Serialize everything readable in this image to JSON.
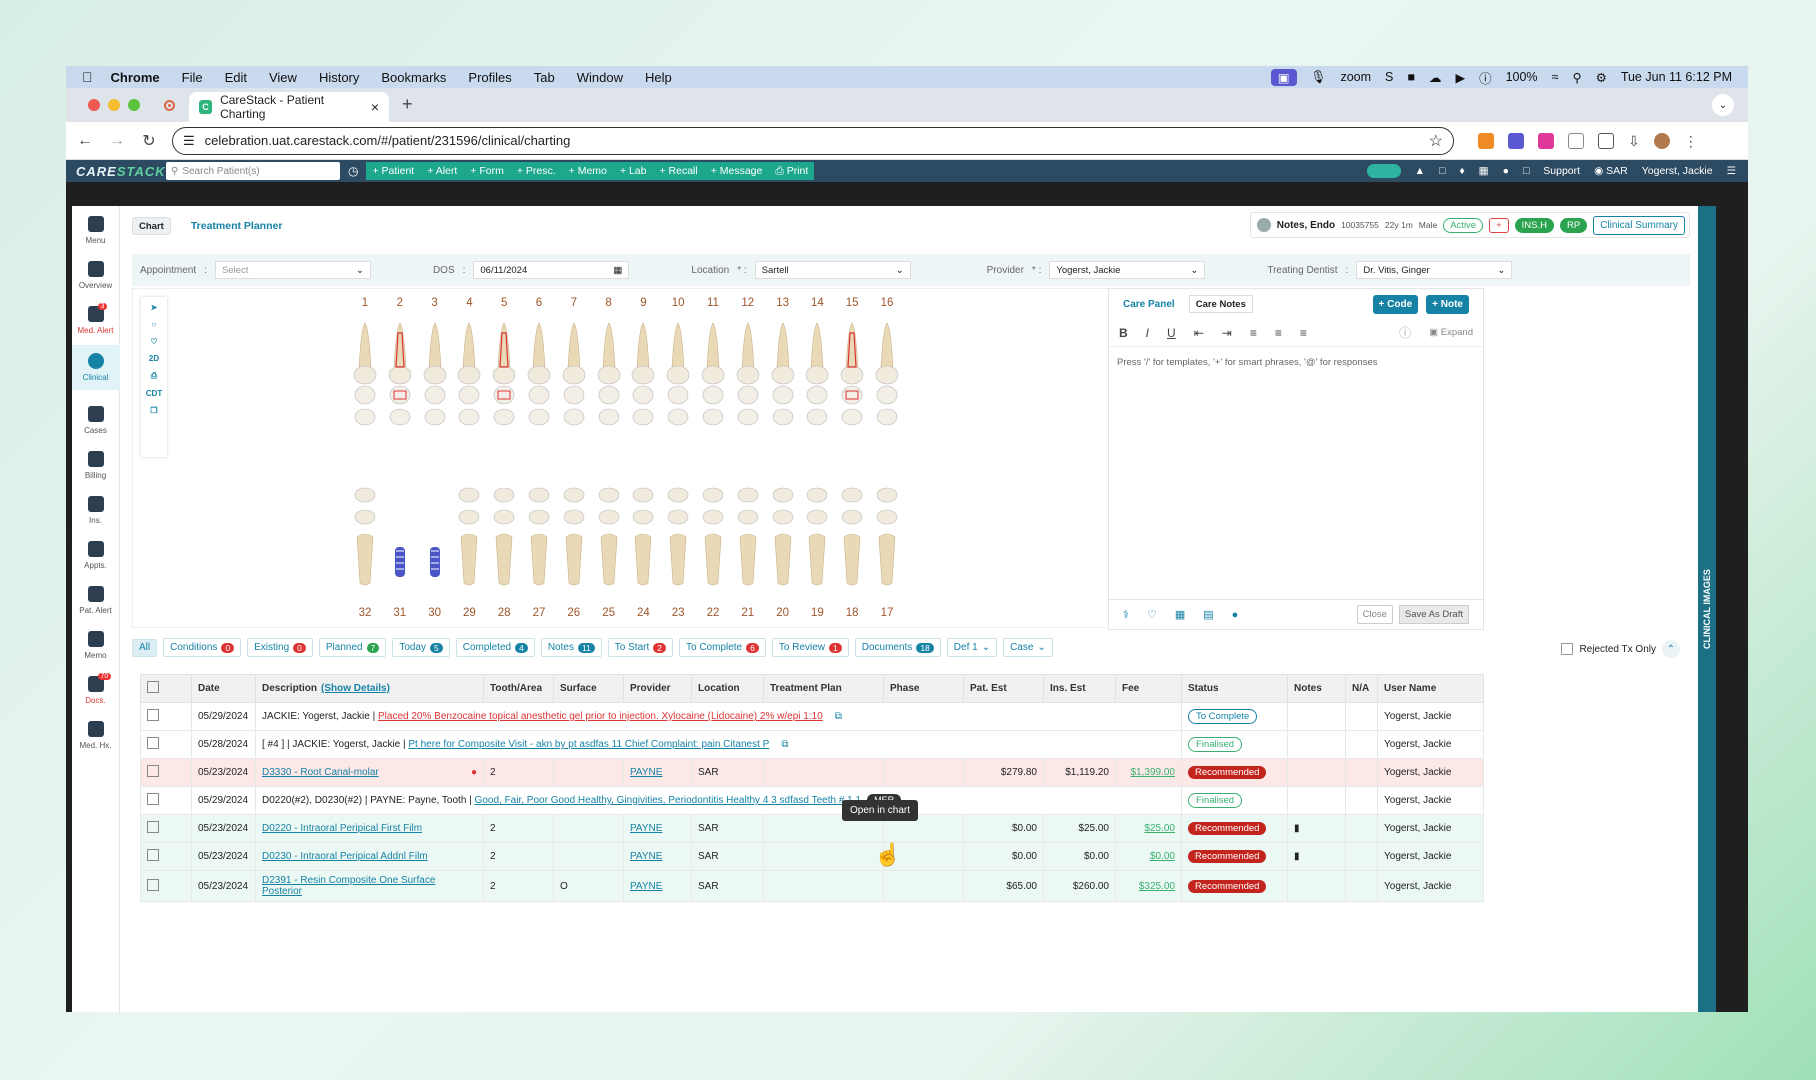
{
  "menubar": {
    "app": "Chrome",
    "items": [
      "File",
      "Edit",
      "View",
      "History",
      "Bookmarks",
      "Profiles",
      "Tab",
      "Window",
      "Help"
    ],
    "zoom": "zoom",
    "battery": "100%",
    "datetime": "Tue Jun 11  6:12 PM"
  },
  "browser": {
    "tab_title": "CareStack - Patient Charting",
    "url": "celebration.uat.carestack.com/#/patient/231596/clinical/charting"
  },
  "appnav": {
    "search_placeholder": "Search Patient(s)",
    "quick": [
      "+ Patient",
      "+ Alert",
      "+ Form",
      "+ Presc.",
      "+ Memo",
      "+ Lab",
      "+ Recall",
      "+ Message",
      "Print"
    ],
    "support": "Support",
    "location": "SAR",
    "user": "Yogerst, Jackie"
  },
  "leftnav": [
    {
      "label": "Menu",
      "icon": "grid-icon"
    },
    {
      "label": "Overview",
      "icon": "person-icon"
    },
    {
      "label": "Med. Alert",
      "icon": "medical-alert-icon",
      "badge": "3"
    },
    {
      "label": "Clinical",
      "icon": "tooth-icon"
    },
    {
      "label": "Cases",
      "icon": "clipboard-icon"
    },
    {
      "label": "Billing",
      "icon": "invoice-icon"
    },
    {
      "label": "Ins.",
      "icon": "shield-icon"
    },
    {
      "label": "Appts.",
      "icon": "calendar-icon"
    },
    {
      "label": "Pat. Alert",
      "icon": "warning-icon"
    },
    {
      "label": "Memo",
      "icon": "memo-icon"
    },
    {
      "label": "Docs.",
      "icon": "docs-icon",
      "badge": "70"
    },
    {
      "label": "Med. Hx.",
      "icon": "history-icon"
    }
  ],
  "subtabs": {
    "chart": "Chart",
    "planner": "Treatment Planner"
  },
  "patient": {
    "name": "Notes, Endo",
    "id": "10035755",
    "age": "22y 1m",
    "sex": "Male",
    "status": "Active",
    "ins": "INS.H",
    "rp": "RP",
    "summary": "Clinical Summary"
  },
  "filters": {
    "appointment_label": "Appointment",
    "appointment_value": "Select",
    "dos_label": "DOS",
    "dos_value": "06/11/2024",
    "location_label": "Location",
    "location_value": "Sartell",
    "provider_label": "Provider",
    "provider_value": "Yogerst, Jackie",
    "dentist_label": "Treating Dentist",
    "dentist_value": "Dr. Vitis, Ginger"
  },
  "teeth_upper": [
    "1",
    "2",
    "3",
    "4",
    "5",
    "6",
    "7",
    "8",
    "9",
    "10",
    "11",
    "12",
    "13",
    "14",
    "15",
    "16"
  ],
  "teeth_lower": [
    "32",
    "31",
    "30",
    "29",
    "28",
    "27",
    "26",
    "25",
    "24",
    "23",
    "22",
    "21",
    "20",
    "19",
    "18",
    "17"
  ],
  "care": {
    "tab_panel": "Care Panel",
    "tab_notes": "Care Notes",
    "code_btn": "+ Code",
    "note_btn": "+ Note",
    "expand": "Expand",
    "placeholder": "Press '/' for templates, '+' for smart phrases, '@' for responses",
    "close": "Close",
    "save": "Save As Draft",
    "side": "CLINICAL IMAGES"
  },
  "chips": [
    {
      "label": "All",
      "count": ""
    },
    {
      "label": "Conditions",
      "count": "0",
      "color": "#d33"
    },
    {
      "label": "Existing",
      "count": "0",
      "color": "#d33"
    },
    {
      "label": "Planned",
      "count": "7",
      "color": "#2ba34f"
    },
    {
      "label": "Today",
      "count": "5",
      "color": "#1683a6"
    },
    {
      "label": "Completed",
      "count": "4",
      "color": "#1683a6"
    },
    {
      "label": "Notes",
      "count": "11",
      "color": "#1683a6"
    },
    {
      "label": "To Start",
      "count": "2",
      "color": "#d33"
    },
    {
      "label": "To Complete",
      "count": "6",
      "color": "#d33"
    },
    {
      "label": "To Review",
      "count": "1",
      "color": "#d33"
    },
    {
      "label": "Documents",
      "count": "18",
      "color": "#1683a6"
    },
    {
      "label": "Def 1",
      "count": ""
    },
    {
      "label": "Case",
      "count": ""
    }
  ],
  "rejected": "Rejected Tx Only",
  "table": {
    "headers": [
      "Date",
      "Description",
      "Tooth/Area",
      "Surface",
      "Provider",
      "Location",
      "Treatment Plan",
      "Phase",
      "Pat. Est",
      "Ins. Est",
      "Fee",
      "Status",
      "Notes",
      "N/A",
      "User Name"
    ],
    "show_details": "(Show Details)",
    "rows": [
      {
        "date": "05/29/2024",
        "desc_prefix": "JACKIE: Yogerst, Jackie | ",
        "desc_link": "Placed 20% Benzocaine topical anesthetic gel prior to injection. Xylocaine (Lidocaine) 2% w/epi 1:10",
        "tooth": "",
        "surface": "",
        "provider": "",
        "location": "",
        "pat": "",
        "ins": "",
        "fee": "",
        "status": "To Complete",
        "user": "Yogerst, Jackie"
      },
      {
        "date": "05/28/2024",
        "desc_prefix": "[ #4 ] | JACKIE: Yogerst, Jackie | ",
        "desc_link": "Pt here for Composite Visit - akn by pt asdfas  11  Chief Complaint: pain  Citanest P",
        "tooth": "",
        "surface": "",
        "provider": "",
        "location": "",
        "pat": "",
        "ins": "",
        "fee": "",
        "status": "Finalised",
        "user": "Yogerst, Jackie"
      },
      {
        "date": "05/23/2024",
        "desc_prefix": "",
        "desc_link": "D3330 - Root Canal-molar",
        "tooth": "2",
        "surface": "",
        "provider": "PAYNE",
        "location": "SAR",
        "pat": "$279.80",
        "ins": "$1,119.20",
        "fee": "$1,399.00",
        "status": "Recommended",
        "user": "Yogerst, Jackie"
      },
      {
        "date": "05/29/2024",
        "desc_prefix": "D0220(#2), D0230(#2) | PAYNE: Payne, Tooth | ",
        "desc_link": "Good, Fair, Poor Good Healthy, Gingivities, Periodontitis Healthy  4 3 sdfasd Teeth # 1 1",
        "tooth": "",
        "surface": "",
        "provider": "",
        "location": "",
        "pat": "",
        "ins": "",
        "fee": "",
        "status": "Finalised",
        "user": "Yogerst, Jackie",
        "mer": "MER"
      },
      {
        "date": "05/23/2024",
        "desc_prefix": "",
        "desc_link": "D0220 - Intraoral Peripical First Film",
        "tooth": "2",
        "surface": "",
        "provider": "PAYNE",
        "location": "SAR",
        "pat": "$0.00",
        "ins": "$25.00",
        "fee": "$25.00",
        "status": "Recommended",
        "user": "Yogerst, Jackie"
      },
      {
        "date": "05/23/2024",
        "desc_prefix": "",
        "desc_link": "D0230 - Intraoral Peripical Addnl Film",
        "tooth": "2",
        "surface": "",
        "provider": "PAYNE",
        "location": "SAR",
        "pat": "$0.00",
        "ins": "$0.00",
        "fee": "$0.00",
        "status": "Recommended",
        "user": "Yogerst, Jackie"
      },
      {
        "date": "05/23/2024",
        "desc_prefix": "",
        "desc_link": "D2391 - Resin Composite One Surface Posterior",
        "tooth": "2",
        "surface": "O",
        "provider": "PAYNE",
        "location": "SAR",
        "pat": "$65.00",
        "ins": "$260.00",
        "fee": "$325.00",
        "status": "Recommended",
        "user": "Yogerst, Jackie"
      }
    ]
  },
  "tooltip": "Open in chart"
}
